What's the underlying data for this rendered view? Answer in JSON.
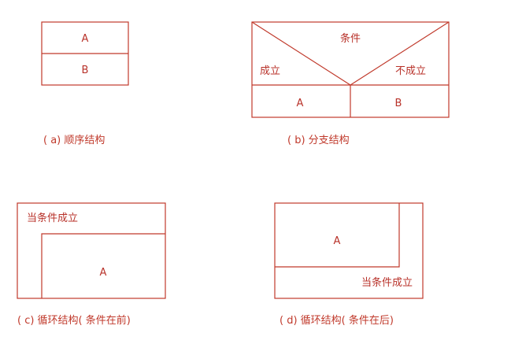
{
  "diagram_a": {
    "top_label": "A",
    "bottom_label": "B",
    "caption": "( a) 顺序结构"
  },
  "diagram_b": {
    "condition_label": "条件",
    "true_label": "成立",
    "false_label": "不成立",
    "left_branch_label": "A",
    "right_branch_label": "B",
    "caption": "( b) 分支结构"
  },
  "diagram_c": {
    "condition_label": "当条件成立",
    "body_label": "A",
    "caption": "( c) 循环结构( 条件在前)"
  },
  "diagram_d": {
    "body_label": "A",
    "condition_label": "当条件成立",
    "caption": "( d) 循环结构( 条件在后)"
  },
  "colors": {
    "line": "#c0392b",
    "text": "#b8322a",
    "background": "#ffffff"
  }
}
